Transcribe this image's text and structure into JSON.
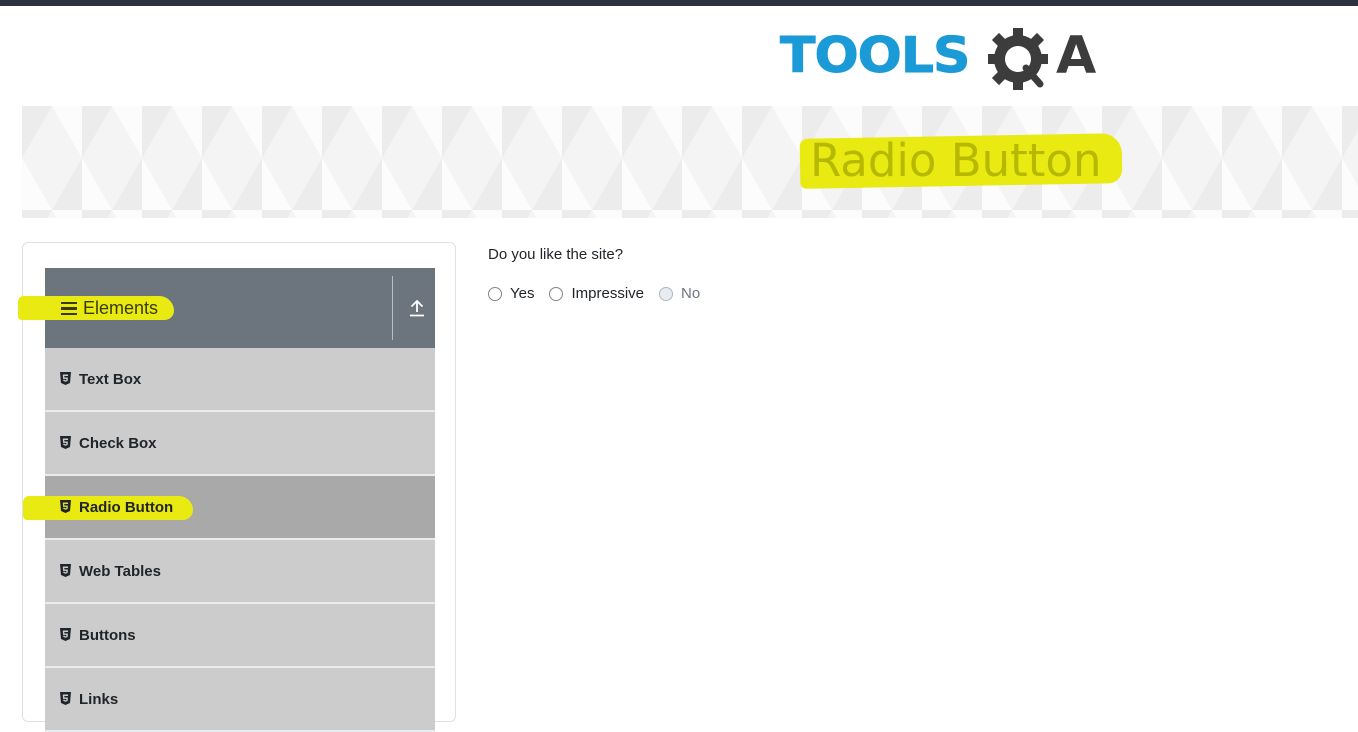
{
  "logo": {
    "text": "TOOLS",
    "suffix": "A",
    "brand_color": "#1a9ad6",
    "icon": "gear-magnifier-icon"
  },
  "banner": {
    "title": "Radio Button"
  },
  "sidebar": {
    "group": {
      "title": "Elements",
      "icon": "bars-icon",
      "toggle_icon": "collapse-arrow-icon"
    },
    "items": [
      {
        "label": "Text Box",
        "icon": "html5-icon"
      },
      {
        "label": "Check Box",
        "icon": "html5-icon"
      },
      {
        "label": "Radio Button",
        "icon": "html5-icon",
        "active": true
      },
      {
        "label": "Web Tables",
        "icon": "html5-icon"
      },
      {
        "label": "Buttons",
        "icon": "html5-icon"
      },
      {
        "label": "Links",
        "icon": "html5-icon"
      }
    ]
  },
  "main": {
    "question": "Do you like the site?",
    "options": [
      {
        "label": "Yes",
        "checked": false,
        "disabled": false
      },
      {
        "label": "Impressive",
        "checked": false,
        "disabled": false
      },
      {
        "label": "No",
        "checked": false,
        "disabled": true
      }
    ]
  },
  "colors": {
    "highlight": "#e8ea12",
    "header_bg": "#6c757d",
    "item_bg": "#cccccc",
    "active_item_bg": "#a9a9a9"
  }
}
